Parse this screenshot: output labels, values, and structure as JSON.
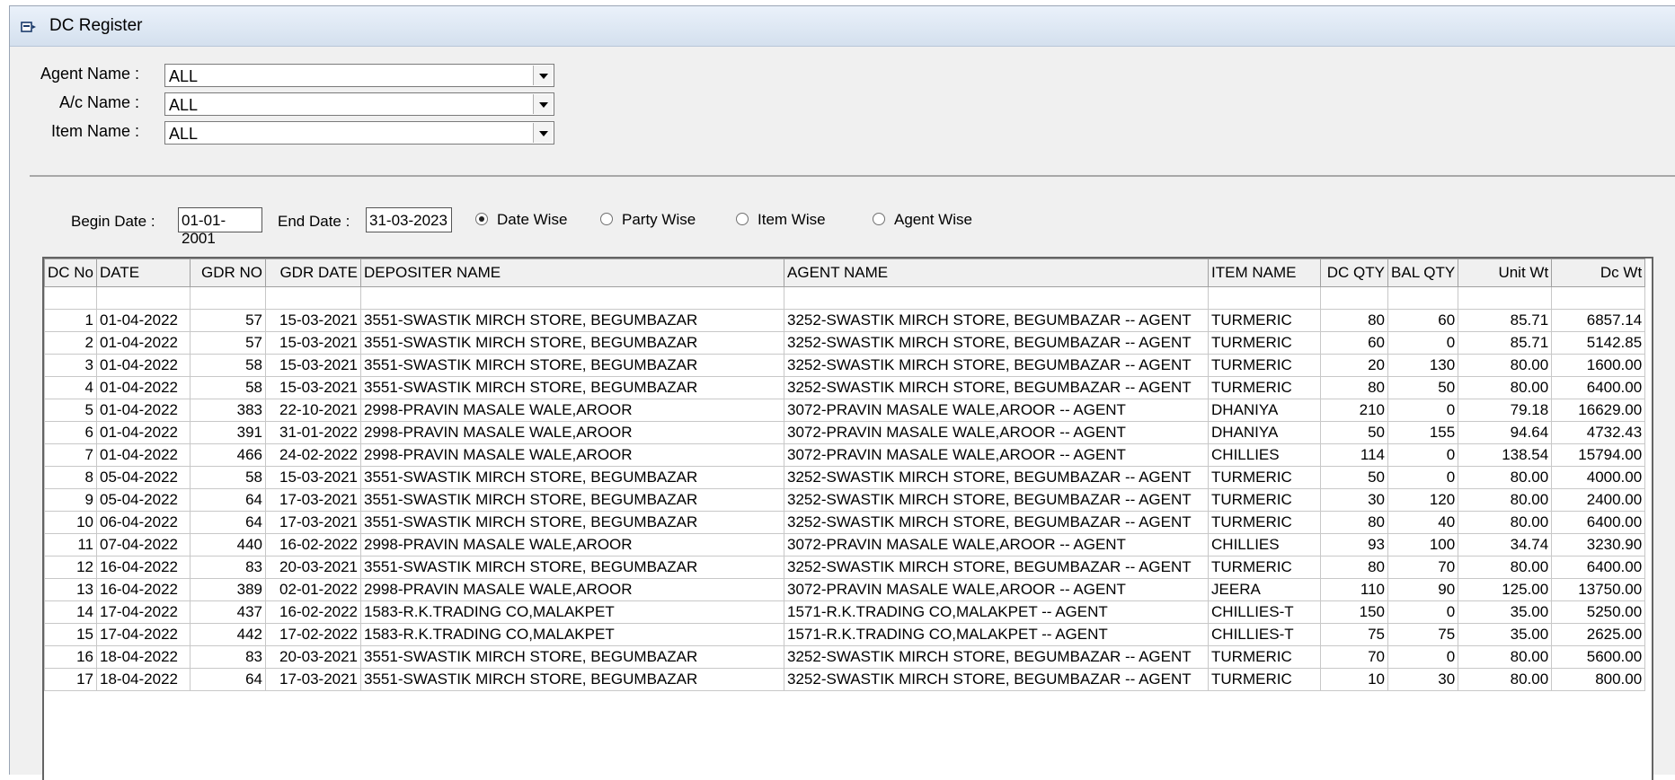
{
  "window": {
    "title": "DC Register"
  },
  "filters": [
    {
      "label": "Agent Name :",
      "value": "ALL"
    },
    {
      "label": "A/c Name :",
      "value": "ALL"
    },
    {
      "label": "Item Name :",
      "value": "ALL"
    }
  ],
  "dates": {
    "begin_label": "Begin Date :",
    "begin_value": "01-01-2001",
    "end_label": "End Date :",
    "end_value": "31-03-2023"
  },
  "radios": [
    {
      "label": "Date Wise",
      "checked": true
    },
    {
      "label": "Party Wise",
      "checked": false
    },
    {
      "label": "Item Wise",
      "checked": false
    },
    {
      "label": "Agent Wise",
      "checked": false
    }
  ],
  "grid": {
    "columns": [
      "DC No",
      "DATE",
      "GDR NO",
      "GDR DATE",
      "DEPOSITER NAME",
      "AGENT NAME",
      "ITEM NAME",
      "DC QTY",
      "BAL QTY",
      "Unit Wt",
      "Dc Wt"
    ],
    "rows": [
      [
        "1",
        "01-04-2022",
        "57",
        "15-03-2021",
        "3551-SWASTIK MIRCH STORE, BEGUMBAZAR",
        "3252-SWASTIK MIRCH STORE, BEGUMBAZAR -- AGENT",
        "TURMERIC",
        "80",
        "60",
        "85.71",
        "6857.14"
      ],
      [
        "2",
        "01-04-2022",
        "57",
        "15-03-2021",
        "3551-SWASTIK MIRCH STORE, BEGUMBAZAR",
        "3252-SWASTIK MIRCH STORE, BEGUMBAZAR -- AGENT",
        "TURMERIC",
        "60",
        "0",
        "85.71",
        "5142.85"
      ],
      [
        "3",
        "01-04-2022",
        "58",
        "15-03-2021",
        "3551-SWASTIK MIRCH STORE, BEGUMBAZAR",
        "3252-SWASTIK MIRCH STORE, BEGUMBAZAR -- AGENT",
        "TURMERIC",
        "20",
        "130",
        "80.00",
        "1600.00"
      ],
      [
        "4",
        "01-04-2022",
        "58",
        "15-03-2021",
        "3551-SWASTIK MIRCH STORE, BEGUMBAZAR",
        "3252-SWASTIK MIRCH STORE, BEGUMBAZAR -- AGENT",
        "TURMERIC",
        "80",
        "50",
        "80.00",
        "6400.00"
      ],
      [
        "5",
        "01-04-2022",
        "383",
        "22-10-2021",
        "2998-PRAVIN MASALE WALE,AROOR",
        "3072-PRAVIN MASALE WALE,AROOR -- AGENT",
        "DHANIYA",
        "210",
        "0",
        "79.18",
        "16629.00"
      ],
      [
        "6",
        "01-04-2022",
        "391",
        "31-01-2022",
        "2998-PRAVIN MASALE WALE,AROOR",
        "3072-PRAVIN MASALE WALE,AROOR -- AGENT",
        "DHANIYA",
        "50",
        "155",
        "94.64",
        "4732.43"
      ],
      [
        "7",
        "01-04-2022",
        "466",
        "24-02-2022",
        "2998-PRAVIN MASALE WALE,AROOR",
        "3072-PRAVIN MASALE WALE,AROOR -- AGENT",
        "CHILLIES",
        "114",
        "0",
        "138.54",
        "15794.00"
      ],
      [
        "8",
        "05-04-2022",
        "58",
        "15-03-2021",
        "3551-SWASTIK MIRCH STORE, BEGUMBAZAR",
        "3252-SWASTIK MIRCH STORE, BEGUMBAZAR -- AGENT",
        "TURMERIC",
        "50",
        "0",
        "80.00",
        "4000.00"
      ],
      [
        "9",
        "05-04-2022",
        "64",
        "17-03-2021",
        "3551-SWASTIK MIRCH STORE, BEGUMBAZAR",
        "3252-SWASTIK MIRCH STORE, BEGUMBAZAR -- AGENT",
        "TURMERIC",
        "30",
        "120",
        "80.00",
        "2400.00"
      ],
      [
        "10",
        "06-04-2022",
        "64",
        "17-03-2021",
        "3551-SWASTIK MIRCH STORE, BEGUMBAZAR",
        "3252-SWASTIK MIRCH STORE, BEGUMBAZAR -- AGENT",
        "TURMERIC",
        "80",
        "40",
        "80.00",
        "6400.00"
      ],
      [
        "11",
        "07-04-2022",
        "440",
        "16-02-2022",
        "2998-PRAVIN MASALE WALE,AROOR",
        "3072-PRAVIN MASALE WALE,AROOR -- AGENT",
        "CHILLIES",
        "93",
        "100",
        "34.74",
        "3230.90"
      ],
      [
        "12",
        "16-04-2022",
        "83",
        "20-03-2021",
        "3551-SWASTIK MIRCH STORE, BEGUMBAZAR",
        "3252-SWASTIK MIRCH STORE, BEGUMBAZAR -- AGENT",
        "TURMERIC",
        "80",
        "70",
        "80.00",
        "6400.00"
      ],
      [
        "13",
        "16-04-2022",
        "389",
        "02-01-2022",
        "2998-PRAVIN MASALE WALE,AROOR",
        "3072-PRAVIN MASALE WALE,AROOR -- AGENT",
        "JEERA",
        "110",
        "90",
        "125.00",
        "13750.00"
      ],
      [
        "14",
        "17-04-2022",
        "437",
        "16-02-2022",
        "1583-R.K.TRADING CO,MALAKPET",
        "1571-R.K.TRADING CO,MALAKPET -- AGENT",
        "CHILLIES-T",
        "150",
        "0",
        "35.00",
        "5250.00"
      ],
      [
        "15",
        "17-04-2022",
        "442",
        "17-02-2022",
        "1583-R.K.TRADING CO,MALAKPET",
        "1571-R.K.TRADING CO,MALAKPET -- AGENT",
        "CHILLIES-T",
        "75",
        "75",
        "35.00",
        "2625.00"
      ],
      [
        "16",
        "18-04-2022",
        "83",
        "20-03-2021",
        "3551-SWASTIK MIRCH STORE, BEGUMBAZAR",
        "3252-SWASTIK MIRCH STORE, BEGUMBAZAR -- AGENT",
        "TURMERIC",
        "70",
        "0",
        "80.00",
        "5600.00"
      ],
      [
        "17",
        "18-04-2022",
        "64",
        "17-03-2021",
        "3551-SWASTIK MIRCH STORE, BEGUMBAZAR",
        "3252-SWASTIK MIRCH STORE, BEGUMBAZAR -- AGENT",
        "TURMERIC",
        "10",
        "30",
        "80.00",
        "800.00"
      ]
    ]
  }
}
